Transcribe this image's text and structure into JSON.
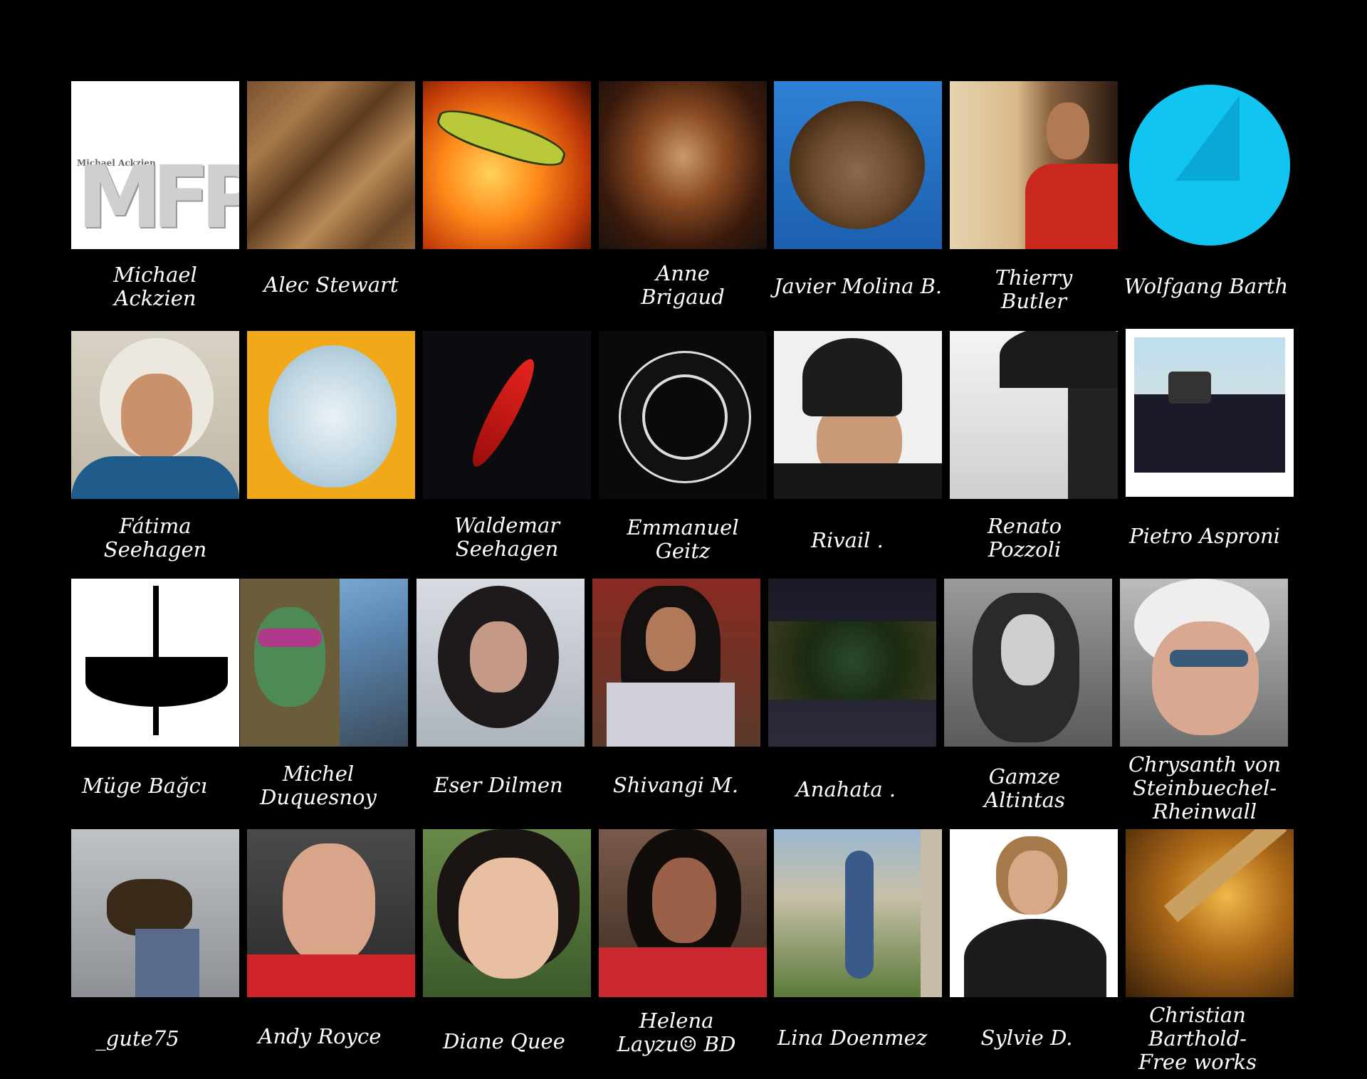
{
  "background": "#000000",
  "people": [
    {
      "name": "Michael\nAckzien",
      "tile_text": "Michael Ackzien",
      "tile_logo": "MFP"
    },
    {
      "name": "Alec Stewart"
    },
    {
      "name": ""
    },
    {
      "name": "Anne\nBrigaud"
    },
    {
      "name": "Javier Molina B."
    },
    {
      "name": "Thierry\nButler"
    },
    {
      "name": "Wolfgang Barth"
    },
    {
      "name": "Fátima\nSeehagen"
    },
    {
      "name": ""
    },
    {
      "name": "Waldemar\nSeehagen"
    },
    {
      "name": "Emmanuel\nGeitz"
    },
    {
      "name": "Rivail ."
    },
    {
      "name": "Renato\nPozzoli"
    },
    {
      "name": "Pietro Asproni"
    },
    {
      "name": "Müge Bağcı"
    },
    {
      "name": "Michel\nDuquesnoy"
    },
    {
      "name": "Eser Dilmen"
    },
    {
      "name": "Shivangi M."
    },
    {
      "name": "Anahata ."
    },
    {
      "name": "Gamze\nAltintas"
    },
    {
      "name": "Chrysanth von\nSteinbuechel-\nRheinwall"
    },
    {
      "name": "_gute75"
    },
    {
      "name": "Andy Royce"
    },
    {
      "name": "Diane Quee"
    },
    {
      "name": "Helena\nLayzu☺ BD"
    },
    {
      "name": "Lina Doenmez"
    },
    {
      "name": "Sylvie D."
    },
    {
      "name": "Christian\nBarthold-\nFree works"
    }
  ]
}
